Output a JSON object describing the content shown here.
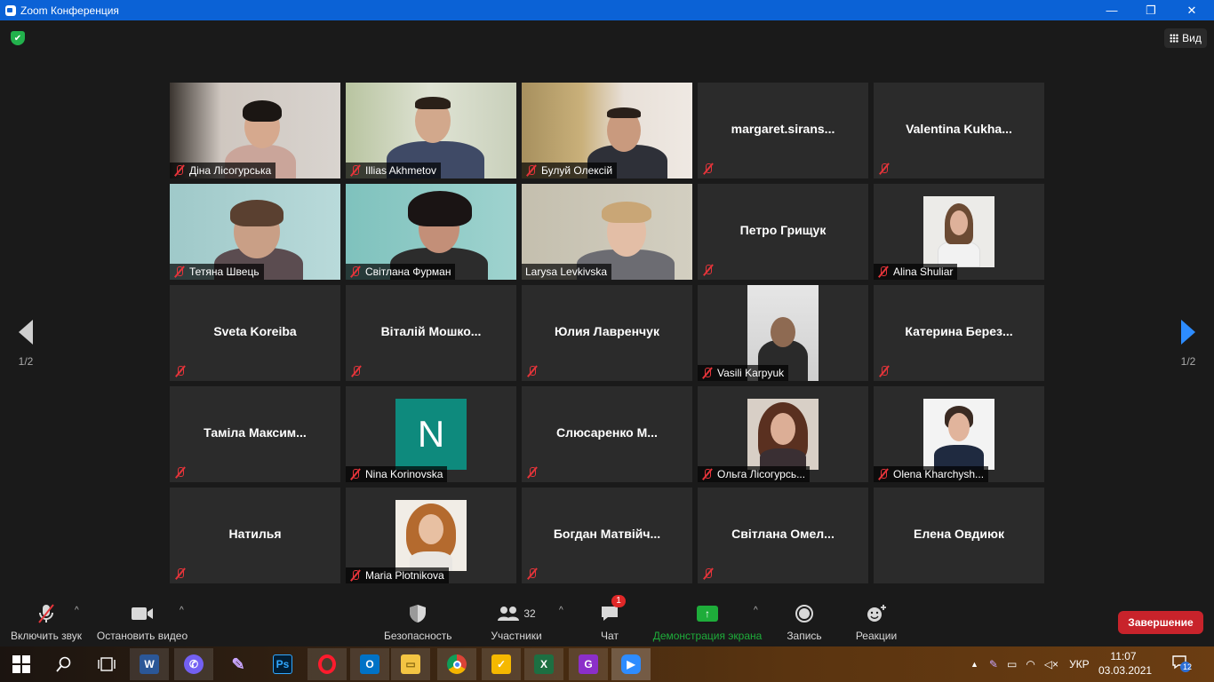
{
  "window": {
    "title": "Zoom Конференция",
    "minimize": "—",
    "maximize": "❐",
    "close": "✕"
  },
  "header": {
    "security_shield": "✔",
    "view_label": "Вид"
  },
  "pagination": {
    "left_page": "1/2",
    "right_page": "1/2"
  },
  "participants": [
    {
      "name": "Діна Лісогурська",
      "video": true,
      "muted": true
    },
    {
      "name": "Illias Akhmetov",
      "video": true,
      "muted": true
    },
    {
      "name": "Булуй Олексій",
      "video": true,
      "muted": true
    },
    {
      "name": "margaret.sirans...",
      "video": false,
      "muted": true
    },
    {
      "name": "Valentina  Kukha...",
      "video": false,
      "muted": true
    },
    {
      "name": "Тетяна Швець",
      "video": true,
      "muted": true
    },
    {
      "name": "Світлана Фурман",
      "video": true,
      "muted": true
    },
    {
      "name": "Larysa Levkivska",
      "video": true,
      "muted": false,
      "active_speaker": true
    },
    {
      "name": "Петро Грищук",
      "video": false,
      "muted": true
    },
    {
      "name": "Alina Shuliar",
      "video": false,
      "avatar": true,
      "muted": true
    },
    {
      "name": "Sveta Koreiba",
      "video": false,
      "muted": true
    },
    {
      "name": "Віталій  Мошко...",
      "video": false,
      "muted": true
    },
    {
      "name": "Юлия Лавренчук",
      "video": false,
      "muted": true
    },
    {
      "name": "Vasili Karpyuk",
      "video": false,
      "avatar": true,
      "muted": true
    },
    {
      "name": "Катерина  Берез...",
      "video": false,
      "muted": true
    },
    {
      "name": "Таміла  Максим...",
      "video": false,
      "muted": true
    },
    {
      "name": "Nina Korinovska",
      "video": false,
      "avatar_letter": "N",
      "muted": true
    },
    {
      "name": "Слюсаренко  М...",
      "video": false,
      "muted": true
    },
    {
      "name": "Ольга Лісогурсь...",
      "video": false,
      "avatar": true,
      "muted": true
    },
    {
      "name": "Olena Kharchysh...",
      "video": false,
      "avatar": true,
      "muted": true
    },
    {
      "name": "Натилья",
      "video": false,
      "muted": true
    },
    {
      "name": "Maria Plotnikova",
      "video": false,
      "avatar": true,
      "muted": true
    },
    {
      "name": "Богдан  Матвійч...",
      "video": false,
      "muted": true
    },
    {
      "name": "Світлана  Омел...",
      "video": false,
      "muted": true
    },
    {
      "name": "Елена Овдиюк",
      "video": false,
      "muted": false
    }
  ],
  "toolbar": {
    "unmute_label": "Включить звук",
    "stop_video_label": "Остановить видео",
    "security_label": "Безопасность",
    "participants_label": "Участники",
    "participants_count": "32",
    "chat_label": "Чат",
    "chat_badge": "1",
    "share_label": "Демонстрация экрана",
    "record_label": "Запись",
    "reactions_label": "Реакции",
    "end_label": "Завершение",
    "caret": "^"
  },
  "taskbar": {
    "apps": [
      "windows-start",
      "search",
      "task-view",
      "word",
      "viber",
      "feather",
      "photoshop",
      "opera",
      "outlook",
      "file-explorer",
      "chrome",
      "sticky-tasks",
      "excel",
      "pdf-app",
      "zoom"
    ],
    "language": "УКР",
    "time": "11:07",
    "date": "03.03.2021",
    "notifications": "12"
  },
  "colors": {
    "titlebar": "#0b62d6",
    "tile_bg": "#2b2b2b",
    "active_speaker_border": "#f5f57a",
    "muted_icon": "#e5343a",
    "share_green": "#1ead3a",
    "end_red": "#c8232b",
    "next_arrow": "#2d8cff"
  }
}
